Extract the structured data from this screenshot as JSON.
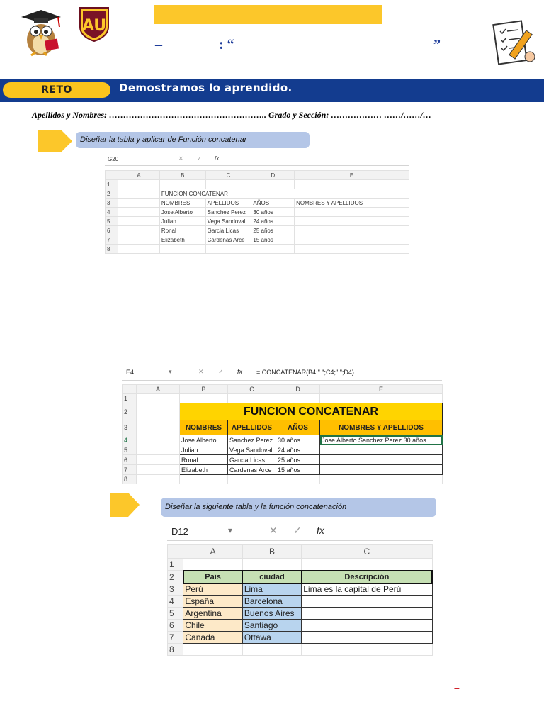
{
  "header": {
    "title_dash": "–",
    "title_colon_quote": ": “",
    "title_close_quote": "”",
    "reto_label": "RETO",
    "reto_title": "Demostramos lo aprendido.",
    "student_line": "Apellidos y Nombres: ……………………………………………….. Grado y Sección: ………………          ……/……/…"
  },
  "instructions": {
    "first": "Diseñar la tabla y aplicar de Función concatenar",
    "second": "Diseñar la siguiente tabla y la función concatenación"
  },
  "sheet1": {
    "namebox": "G20",
    "cancel": "✕",
    "enter": "✓",
    "fx": "fx",
    "columns": [
      "A",
      "B",
      "C",
      "D",
      "E"
    ],
    "rows": [
      "1",
      "2",
      "3",
      "4",
      "5",
      "6",
      "7",
      "8"
    ],
    "title": "FUNCION CONCATENAR",
    "headers": [
      "NOMBRES",
      "APELLIDOS",
      "AÑOS",
      "NOMBRES Y APELLIDOS"
    ],
    "data": [
      [
        "Jose  Alberto",
        "Sanchez Perez",
        "30 años"
      ],
      [
        "Julian",
        "Vega Sandoval",
        " 24 años"
      ],
      [
        "Ronal",
        "Garcia Licas",
        "25 años"
      ],
      [
        "Elizabeth",
        "Cardenas Arce",
        "15 años"
      ]
    ]
  },
  "sheet2": {
    "namebox": "E4",
    "dropdown": "▾",
    "cancel": "✕",
    "enter": "✓",
    "fx": "fx",
    "formula": "= CONCATENAR(B4;\" \";C4;\"  \";D4)",
    "columns": [
      "A",
      "B",
      "C",
      "D",
      "E"
    ],
    "rows": [
      "1",
      "2",
      "3",
      "4",
      "5",
      "6",
      "7",
      "8"
    ],
    "title": "FUNCION CONCATENAR",
    "headers": [
      "NOMBRES",
      "APELLIDOS",
      "AÑOS",
      "NOMBRES Y APELLIDOS"
    ],
    "data": [
      [
        "Jose  Alberto",
        "Sanchez Perez",
        "30 años",
        "Jose  Alberto Sanchez Perez  30 años"
      ],
      [
        "Julian",
        "Vega Sandoval",
        " 24 años",
        ""
      ],
      [
        "Ronal",
        "Garcia Licas",
        "25 años",
        ""
      ],
      [
        "Elizabeth",
        "Cardenas Arce",
        "15 años",
        ""
      ]
    ]
  },
  "sheet3": {
    "namebox": "D12",
    "dropdown": "▾",
    "cancel": "✕",
    "enter": "✓",
    "fx": "fx",
    "columns": [
      "A",
      "B",
      "C"
    ],
    "rows": [
      "1",
      "2",
      "3",
      "4",
      "5",
      "6",
      "7",
      "8"
    ],
    "headers": [
      "Pais",
      "ciudad",
      "Descripción"
    ],
    "data": [
      [
        "Perú",
        "Lima",
        "Lima  es la capital de Perú"
      ],
      [
        "España",
        "Barcelona",
        ""
      ],
      [
        "Argentina",
        "Buenos Aires",
        ""
      ],
      [
        "Chile",
        "Santiago",
        ""
      ],
      [
        "Canada",
        "Ottawa",
        ""
      ]
    ]
  },
  "footer": {
    "mark": "–"
  },
  "colors": {
    "yellow": "#fcc72a",
    "band": "#133c8f",
    "instruction": "#b4c6e7",
    "accent_red": "#d0202a"
  }
}
